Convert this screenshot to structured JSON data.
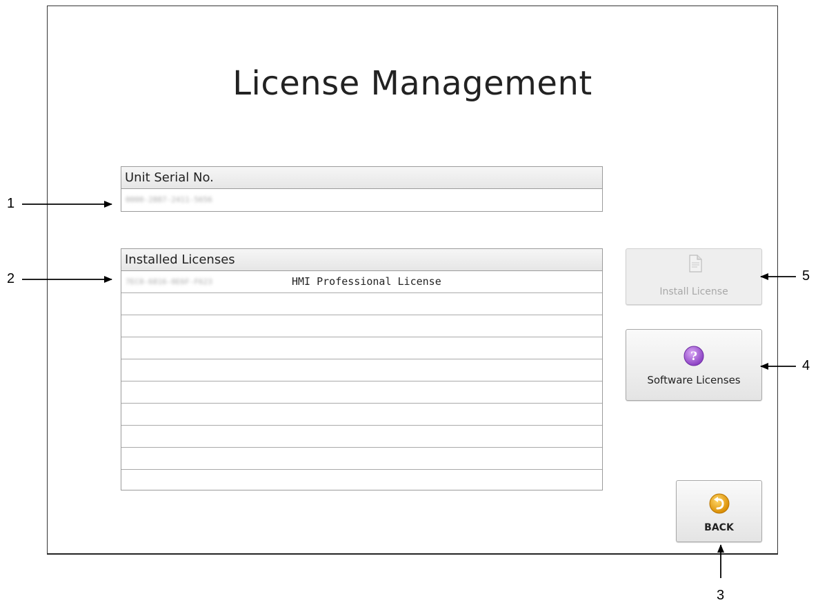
{
  "page": {
    "title": "License Management"
  },
  "serial": {
    "header": "Unit Serial No.",
    "value_redacted": "0000-2887-2411-5656"
  },
  "licenses": {
    "header": "Installed Licenses",
    "rows": [
      {
        "key_redacted": "7EC0-6816-0E6F-F623",
        "name": "HMI Professional License"
      },
      {
        "key_redacted": "",
        "name": ""
      },
      {
        "key_redacted": "",
        "name": ""
      },
      {
        "key_redacted": "",
        "name": ""
      },
      {
        "key_redacted": "",
        "name": ""
      },
      {
        "key_redacted": "",
        "name": ""
      },
      {
        "key_redacted": "",
        "name": ""
      },
      {
        "key_redacted": "",
        "name": ""
      },
      {
        "key_redacted": "",
        "name": ""
      },
      {
        "key_redacted": "",
        "name": ""
      }
    ]
  },
  "buttons": {
    "install": {
      "label": "Install License",
      "icon": "install-document-icon",
      "state": "disabled"
    },
    "software": {
      "label": "Software Licenses",
      "icon": "question-icon",
      "icon_color": "#9b4dca"
    },
    "back": {
      "label": "BACK",
      "icon": "back-arrow-icon",
      "icon_color": "#e8a316"
    }
  },
  "callouts": [
    "1",
    "2",
    "3",
    "4",
    "5"
  ]
}
